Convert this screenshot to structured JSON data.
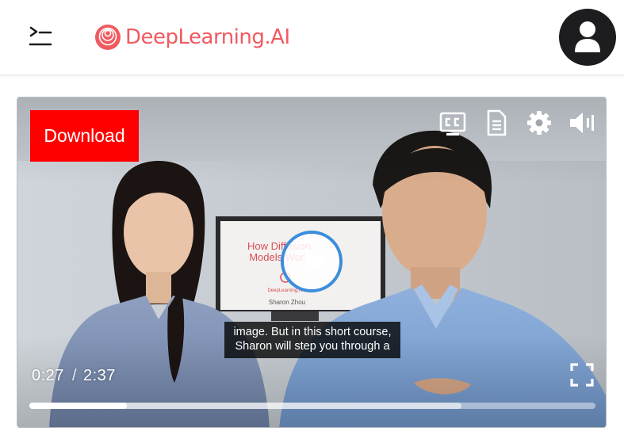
{
  "header": {
    "logo_text": "DeepLearning.AI",
    "brand_color": "#f05a5f",
    "menu_icon": "menu-indent-icon",
    "avatar_icon": "user-icon"
  },
  "player": {
    "download_label": "Download",
    "download_color": "#ff0000",
    "controls": {
      "captions_icon": "closed-captions-icon",
      "transcript_icon": "transcript-document-icon",
      "settings_icon": "gear-icon",
      "volume_icon": "volume-icon",
      "play_icon": "play-icon",
      "fullscreen_icon": "fullscreen-icon"
    },
    "slide": {
      "title_line1": "How Diffusion",
      "title_line2": "Models Work",
      "logo_caption": "DeepLearning.AI",
      "presenter": "Sharon Zhou"
    },
    "caption_line1": "image. But in this short course,",
    "caption_line2": "Sharon will step you through a",
    "current_time": "0:27",
    "time_separator": "/",
    "duration": "2:37",
    "played_fraction": 0.172,
    "buffered_fraction": 0.764
  }
}
